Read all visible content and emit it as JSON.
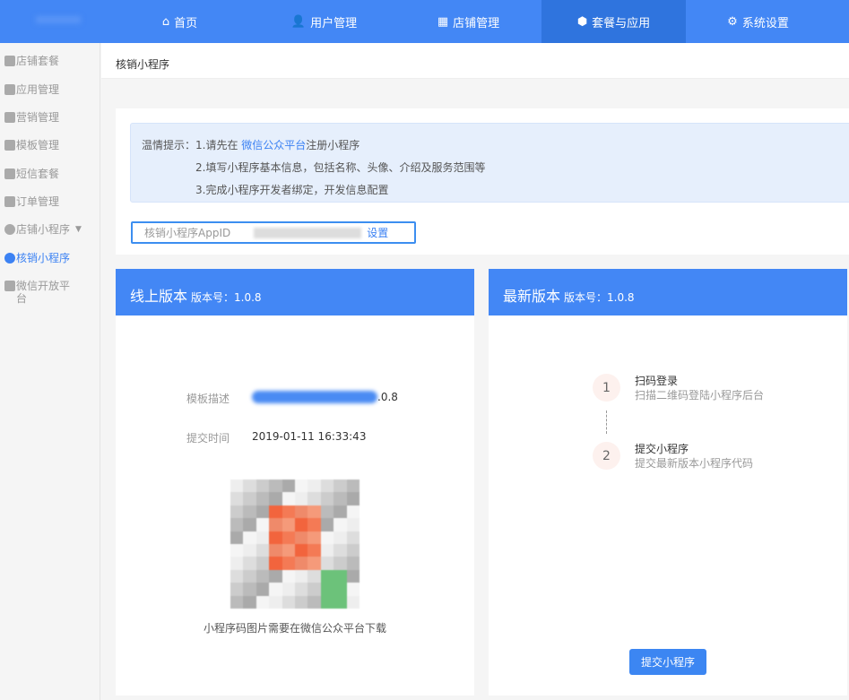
{
  "topnav": [
    {
      "label": "首页",
      "icon": "home-icon"
    },
    {
      "label": "用户管理",
      "icon": "user-icon"
    },
    {
      "label": "店铺管理",
      "icon": "store-icon"
    },
    {
      "label": "套餐与应用",
      "icon": "package-icon",
      "active": true
    },
    {
      "label": "系统设置",
      "icon": "gear-icon"
    }
  ],
  "sidebar": {
    "items": [
      {
        "label": "店铺套餐"
      },
      {
        "label": "应用管理"
      },
      {
        "label": "营销管理"
      },
      {
        "label": "模板管理"
      },
      {
        "label": "短信套餐"
      },
      {
        "label": "订单管理"
      },
      {
        "label": "店铺小程序"
      },
      {
        "label": "核销小程序",
        "active": true
      },
      {
        "label": "微信开放平台"
      }
    ]
  },
  "breadcrumb": "核销小程序",
  "tip": {
    "prefix": "温情提示：",
    "line1_a": "1.请先在 ",
    "line1_link": "微信公众平台",
    "line1_b": "注册小程序",
    "line2": "2.填写小程序基本信息，包括名称、头像、介绍及服务范围等",
    "line3": "3.完成小程序开发者绑定，开发信息配置"
  },
  "appid": {
    "label": "核销小程序AppID",
    "action": "设置"
  },
  "online": {
    "title": "线上版本",
    "version_label": "版本号：1.0.8",
    "desc_label": "模板描述",
    "desc_value": ".0.8",
    "time_label": "提交时间",
    "time_value": "2019-01-11 16:33:43",
    "qr_caption": "小程序码图片需要在微信公众平台下载"
  },
  "latest": {
    "title": "最新版本",
    "version_label": "版本号：1.0.8",
    "steps": [
      {
        "num": "1",
        "title": "扫码登录",
        "desc": "扫描二维码登陆小程序后台"
      },
      {
        "num": "2",
        "title": "提交小程序",
        "desc": "提交最新版本小程序代码"
      }
    ],
    "submit": "提交小程序"
  },
  "colors": {
    "primary": "#4387f5",
    "active_nav": "#2f74de",
    "link": "#3c82f3"
  }
}
